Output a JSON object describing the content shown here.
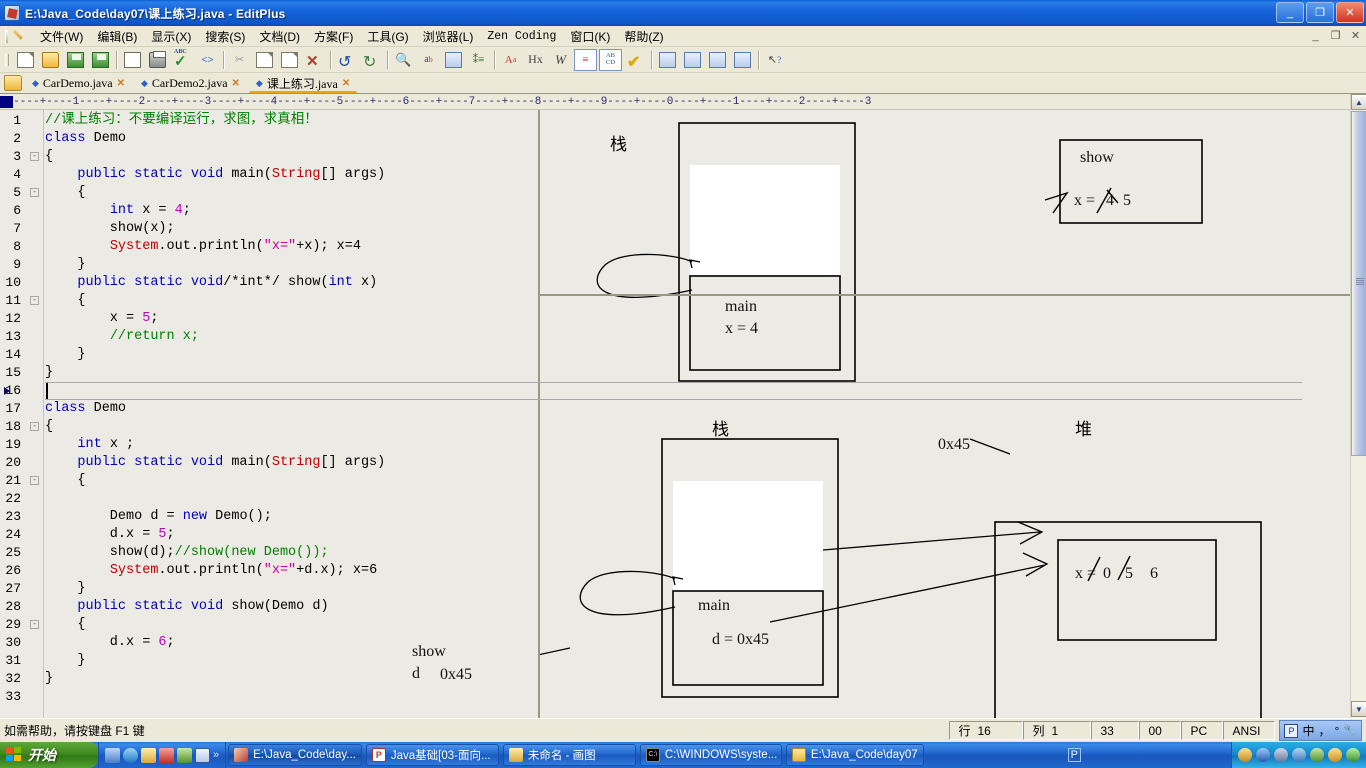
{
  "window": {
    "title": "E:\\Java_Code\\day07\\课上练习.java - EditPlus",
    "icon": "editplus-icon",
    "minimize": "_",
    "maximize": "❐",
    "close": "✕",
    "mdi_minimize": "_",
    "mdi_restore": "❐",
    "mdi_close": "✕"
  },
  "menubar": {
    "items": [
      {
        "label": "文件(W)"
      },
      {
        "label": "编辑(B)"
      },
      {
        "label": "显示(X)"
      },
      {
        "label": "搜索(S)"
      },
      {
        "label": "文档(D)"
      },
      {
        "label": "方案(F)"
      },
      {
        "label": "工具(G)"
      },
      {
        "label": "浏览器(L)"
      },
      {
        "label": "Zen Coding"
      },
      {
        "label": "窗口(K)"
      },
      {
        "label": "帮助(Z)"
      }
    ]
  },
  "toolbar": {
    "buttons": [
      {
        "name": "new-file",
        "glyph": ""
      },
      {
        "name": "open-file",
        "glyph": ""
      },
      {
        "name": "save-file",
        "glyph": ""
      },
      {
        "name": "save-all",
        "glyph": ""
      },
      {
        "name": "print-preview",
        "glyph": ""
      },
      {
        "name": "print",
        "glyph": ""
      },
      {
        "name": "spell-check",
        "glyph": ""
      },
      {
        "name": "view-source",
        "glyph": "<>"
      },
      {
        "name": "cut",
        "glyph": "✂"
      },
      {
        "name": "copy",
        "glyph": ""
      },
      {
        "name": "paste",
        "glyph": ""
      },
      {
        "name": "delete",
        "glyph": "✕"
      },
      {
        "name": "undo",
        "glyph": "↺"
      },
      {
        "name": "redo",
        "glyph": "↻"
      },
      {
        "name": "find",
        "glyph": "🔍"
      },
      {
        "name": "replace",
        "glyph": "ab"
      },
      {
        "name": "find-in-files",
        "glyph": ""
      },
      {
        "name": "goto-line",
        "glyph": ""
      },
      {
        "name": "change-case",
        "glyph": "Aa"
      },
      {
        "name": "hex-view",
        "glyph": "Hx"
      },
      {
        "name": "word-wrap",
        "glyph": "W"
      },
      {
        "name": "line-numbers",
        "glyph": "≡"
      },
      {
        "name": "clipboard-text",
        "glyph": "AB"
      },
      {
        "name": "run-compile",
        "glyph": "✓"
      },
      {
        "name": "document-selector",
        "glyph": ""
      },
      {
        "name": "directory-window",
        "glyph": ""
      },
      {
        "name": "clip-library",
        "glyph": ""
      },
      {
        "name": "output-window",
        "glyph": ""
      },
      {
        "name": "context-help",
        "glyph": "?"
      }
    ]
  },
  "tabs": [
    {
      "label": "CarDemo.java",
      "active": false
    },
    {
      "label": "CarDemo2.java",
      "active": false
    },
    {
      "label": "课上练习.java",
      "active": true
    }
  ],
  "editor": {
    "ruler": "----+----1----+----2----+----3----+----4----+----5----+----6----+----7----+----8----+----9----+----0----+----1----+----2----+----3",
    "current_line": 16,
    "lines": [
      {
        "n": 1,
        "fold": "",
        "text": "//课上练习：不要编译运行，求图，求真相！",
        "tokens": [
          {
            "t": "//课上练习：不要编译运行，求图，求真相！",
            "c": "cmt"
          }
        ]
      },
      {
        "n": 2,
        "fold": "",
        "text": "class Demo",
        "tokens": [
          {
            "t": "class",
            "c": "kw"
          },
          {
            "t": " Demo",
            "c": ""
          }
        ]
      },
      {
        "n": 3,
        "fold": "-",
        "text": "{",
        "tokens": [
          {
            "t": "{",
            "c": ""
          }
        ]
      },
      {
        "n": 4,
        "fold": "",
        "text": "    public static void main(String[] args)",
        "tokens": [
          {
            "t": "    ",
            "c": ""
          },
          {
            "t": "public static void",
            "c": "kw"
          },
          {
            "t": " main(",
            "c": ""
          },
          {
            "t": "String",
            "c": "cls"
          },
          {
            "t": "[] args)",
            "c": ""
          }
        ]
      },
      {
        "n": 5,
        "fold": "-",
        "text": "    {",
        "tokens": [
          {
            "t": "    {",
            "c": ""
          }
        ]
      },
      {
        "n": 6,
        "fold": "",
        "text": "        int x = 4;",
        "tokens": [
          {
            "t": "        ",
            "c": ""
          },
          {
            "t": "int",
            "c": "kw"
          },
          {
            "t": " x = ",
            "c": ""
          },
          {
            "t": "4",
            "c": "num"
          },
          {
            "t": ";",
            "c": ""
          }
        ]
      },
      {
        "n": 7,
        "fold": "",
        "text": "        show(x);",
        "tokens": [
          {
            "t": "        show(x);",
            "c": ""
          }
        ]
      },
      {
        "n": 8,
        "fold": "",
        "text": "        System.out.println(\"x=\"+x); x=4",
        "tokens": [
          {
            "t": "        ",
            "c": ""
          },
          {
            "t": "System",
            "c": "cls"
          },
          {
            "t": ".out.println(",
            "c": ""
          },
          {
            "t": "\"x=\"",
            "c": "str"
          },
          {
            "t": "+x); x=4",
            "c": ""
          }
        ]
      },
      {
        "n": 9,
        "fold": "",
        "text": "    }",
        "tokens": [
          {
            "t": "    }",
            "c": ""
          }
        ]
      },
      {
        "n": 10,
        "fold": "",
        "text": "    public static void/*int*/ show(int x)",
        "tokens": [
          {
            "t": "    ",
            "c": ""
          },
          {
            "t": "public static void",
            "c": "kw"
          },
          {
            "t": "/*int*/",
            "c": ""
          },
          {
            "t": " show(",
            "c": ""
          },
          {
            "t": "int",
            "c": "kw"
          },
          {
            "t": " x)",
            "c": ""
          }
        ]
      },
      {
        "n": 11,
        "fold": "-",
        "text": "    {",
        "tokens": [
          {
            "t": "    {",
            "c": ""
          }
        ]
      },
      {
        "n": 12,
        "fold": "",
        "text": "        x = 5;",
        "tokens": [
          {
            "t": "        x = ",
            "c": ""
          },
          {
            "t": "5",
            "c": "num"
          },
          {
            "t": ";",
            "c": ""
          }
        ]
      },
      {
        "n": 13,
        "fold": "",
        "text": "        //return x;",
        "tokens": [
          {
            "t": "        ",
            "c": ""
          },
          {
            "t": "//return x;",
            "c": "cmt"
          }
        ]
      },
      {
        "n": 14,
        "fold": "",
        "text": "    }",
        "tokens": [
          {
            "t": "    }",
            "c": ""
          }
        ]
      },
      {
        "n": 15,
        "fold": "",
        "text": "}",
        "tokens": [
          {
            "t": "}",
            "c": ""
          }
        ]
      },
      {
        "n": 16,
        "fold": "",
        "text": "",
        "tokens": []
      },
      {
        "n": 17,
        "fold": "",
        "text": "class Demo",
        "tokens": [
          {
            "t": "class",
            "c": "kw"
          },
          {
            "t": " Demo",
            "c": ""
          }
        ]
      },
      {
        "n": 18,
        "fold": "-",
        "text": "{",
        "tokens": [
          {
            "t": "{",
            "c": ""
          }
        ]
      },
      {
        "n": 19,
        "fold": "",
        "text": "    int x ;",
        "tokens": [
          {
            "t": "    ",
            "c": ""
          },
          {
            "t": "int",
            "c": "kw"
          },
          {
            "t": " x ;",
            "c": ""
          }
        ]
      },
      {
        "n": 20,
        "fold": "",
        "text": "    public static void main(String[] args)",
        "tokens": [
          {
            "t": "    ",
            "c": ""
          },
          {
            "t": "public static void",
            "c": "kw"
          },
          {
            "t": " main(",
            "c": ""
          },
          {
            "t": "String",
            "c": "cls"
          },
          {
            "t": "[] args)",
            "c": ""
          }
        ]
      },
      {
        "n": 21,
        "fold": "-",
        "text": "    {",
        "tokens": [
          {
            "t": "    {",
            "c": ""
          }
        ]
      },
      {
        "n": 22,
        "fold": "",
        "text": "",
        "tokens": []
      },
      {
        "n": 23,
        "fold": "",
        "text": "        Demo d = new Demo();",
        "tokens": [
          {
            "t": "        Demo d = ",
            "c": ""
          },
          {
            "t": "new",
            "c": "kw"
          },
          {
            "t": " Demo();",
            "c": ""
          }
        ]
      },
      {
        "n": 24,
        "fold": "",
        "text": "        d.x = 5;",
        "tokens": [
          {
            "t": "        d.x = ",
            "c": ""
          },
          {
            "t": "5",
            "c": "num"
          },
          {
            "t": ";",
            "c": ""
          }
        ]
      },
      {
        "n": 25,
        "fold": "",
        "text": "        show(d);//show(new Demo());",
        "tokens": [
          {
            "t": "        show(d);",
            "c": ""
          },
          {
            "t": "//show(new Demo());",
            "c": "cmt"
          }
        ]
      },
      {
        "n": 26,
        "fold": "",
        "text": "        System.out.println(\"x=\"+d.x); x=6",
        "tokens": [
          {
            "t": "        ",
            "c": ""
          },
          {
            "t": "System",
            "c": "cls"
          },
          {
            "t": ".out.println(",
            "c": ""
          },
          {
            "t": "\"x=\"",
            "c": "str"
          },
          {
            "t": "+d.x); x=6",
            "c": ""
          }
        ]
      },
      {
        "n": 27,
        "fold": "",
        "text": "    }",
        "tokens": [
          {
            "t": "    }",
            "c": ""
          }
        ]
      },
      {
        "n": 28,
        "fold": "",
        "text": "    public static void show(Demo d)",
        "tokens": [
          {
            "t": "    ",
            "c": ""
          },
          {
            "t": "public static void",
            "c": "kw"
          },
          {
            "t": " show(Demo d)",
            "c": ""
          }
        ]
      },
      {
        "n": 29,
        "fold": "-",
        "text": "    {",
        "tokens": [
          {
            "t": "    {",
            "c": ""
          }
        ]
      },
      {
        "n": 30,
        "fold": "",
        "text": "        d.x = 6;",
        "tokens": [
          {
            "t": "        d.x = ",
            "c": ""
          },
          {
            "t": "6",
            "c": "num"
          },
          {
            "t": ";",
            "c": ""
          }
        ]
      },
      {
        "n": 31,
        "fold": "",
        "text": "    }",
        "tokens": [
          {
            "t": "    }",
            "c": ""
          }
        ]
      },
      {
        "n": 32,
        "fold": "",
        "text": "}",
        "tokens": [
          {
            "t": "}",
            "c": ""
          }
        ]
      },
      {
        "n": 33,
        "fold": "",
        "text": "",
        "tokens": []
      }
    ]
  },
  "diagram": {
    "top": {
      "stack_label": "栈",
      "main_frame_title": "main",
      "main_frame_value": "x = 4",
      "show_frame_title": "show",
      "show_frame_value_old": "4",
      "show_frame_value_new": "5",
      "show_frame_prefix": "x = "
    },
    "bottom": {
      "stack_label": "栈",
      "heap_label": "堆",
      "main_frame_title": "main",
      "main_frame_value": "d = 0x45",
      "show_frame_title": "show",
      "show_frame_var": "d",
      "show_frame_value": "0x45",
      "heap_address": "0x45",
      "heap_object_prefix": "x = ",
      "heap_object_v0": "0",
      "heap_object_v1": "5",
      "heap_object_v2": "6"
    }
  },
  "statusbar": {
    "message": "如需帮助，请按键盘 F1 键",
    "row_label": "行",
    "row_value": "16",
    "col_label": "列",
    "col_value": "1",
    "chars": "33",
    "sel": "00",
    "eol": "PC",
    "encoding": "ANSI",
    "ime_mode": "中",
    "ime_punct": "，",
    "ime_shape": "°",
    "ime_tool": "🔧"
  },
  "taskbar": {
    "start": "开始",
    "quicklaunch": [
      {
        "name": "show-desktop-icon"
      },
      {
        "name": "internet-explorer-icon"
      },
      {
        "name": "paint-icon"
      },
      {
        "name": "media-icon"
      },
      {
        "name": "tool-icon"
      },
      {
        "name": "word-icon"
      },
      {
        "name": "expand-chevron-icon"
      }
    ],
    "tasks": [
      {
        "label": "E:\\Java_Code\\day...",
        "icon": "editplus-icon",
        "active": true
      },
      {
        "label": "Java基础[03-面向...",
        "icon": "powerpoint-icon",
        "active": false
      },
      {
        "label": "未命名 - 画图",
        "icon": "paint-icon",
        "active": false
      },
      {
        "label": "C:\\WINDOWS\\syste...",
        "icon": "console-icon",
        "active": false
      },
      {
        "label": "E:\\Java_Code\\day07",
        "icon": "folder-icon",
        "active": false
      }
    ],
    "tray_note": "P"
  }
}
